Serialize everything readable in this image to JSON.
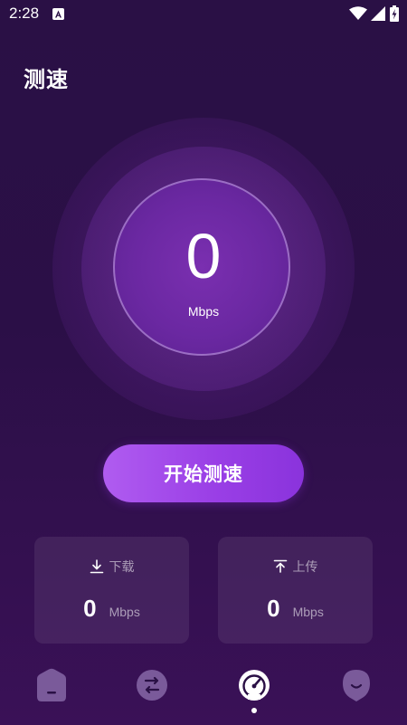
{
  "status_bar": {
    "time": "2:28",
    "icons": [
      "accessibility-a-icon",
      "wifi-icon",
      "signal-icon",
      "battery-charging-icon"
    ]
  },
  "page": {
    "title": "测速"
  },
  "gauge": {
    "value": "0",
    "unit": "Mbps"
  },
  "start_button": {
    "label": "开始测速"
  },
  "stats": {
    "download": {
      "label": "下载",
      "value": "0",
      "unit": "Mbps",
      "icon": "download-icon"
    },
    "upload": {
      "label": "上传",
      "value": "0",
      "unit": "Mbps",
      "icon": "upload-icon"
    }
  },
  "bottom_nav": {
    "items": [
      {
        "id": "home",
        "icon": "home-icon",
        "active": false
      },
      {
        "id": "exchange",
        "icon": "exchange-icon",
        "active": false
      },
      {
        "id": "speed",
        "icon": "speedometer-icon",
        "active": true
      },
      {
        "id": "profile",
        "icon": "profile-icon",
        "active": false
      }
    ]
  },
  "colors": {
    "background": "#2a1045",
    "accent": "#9a3fe6",
    "gauge_core": "#7a2fb0",
    "muted_text": "#a896b8"
  }
}
